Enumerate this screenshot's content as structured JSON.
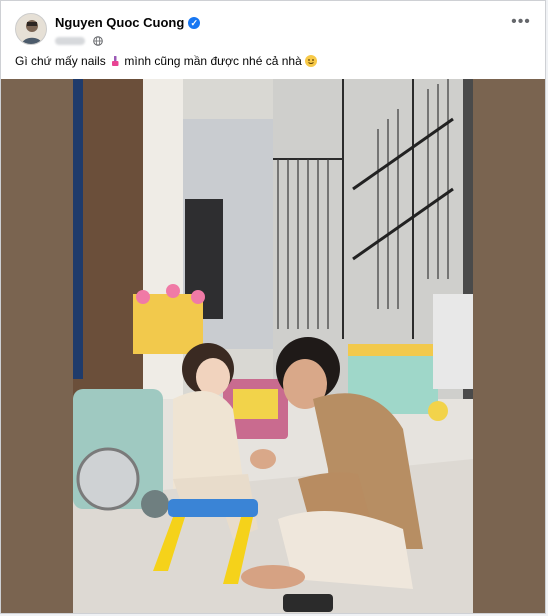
{
  "post": {
    "author": "Nguyen Quoc Cuong",
    "verified_icon": "verified-badge-icon",
    "privacy_icon": "globe-icon",
    "more_label": "•••",
    "caption_part1": "Gì chứ mấy nails ",
    "caption_part2": " mình cũng mần được nhé cả nhà ",
    "nail_emoji": "nail-polish-icon",
    "smile_emoji": "smiling-face-icon"
  },
  "colors": {
    "brand": "#1877f2",
    "frame_background": "#7a6450"
  }
}
